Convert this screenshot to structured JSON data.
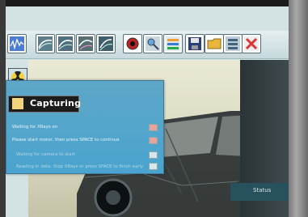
{
  "toolbar": {
    "buttons": [
      {
        "name": "waveform-icon",
        "color": "#4c7bd1"
      },
      {
        "name": "scan-1-icon"
      },
      {
        "name": "scan-2-icon"
      },
      {
        "name": "scan-3-icon"
      },
      {
        "name": "scan-4-icon"
      },
      {
        "name": "lens-icon"
      },
      {
        "name": "magnify-icon"
      },
      {
        "name": "filter-icon"
      },
      {
        "name": "save-icon"
      },
      {
        "name": "open-folder-icon"
      },
      {
        "name": "image-list-icon"
      },
      {
        "name": "delete-icon",
        "color": "#d33"
      }
    ]
  },
  "dialog": {
    "title": "Capturing",
    "steps": [
      {
        "text": "Waiting for XRays on",
        "state": "active"
      },
      {
        "text": "Please start motor, then press SPACE to continue",
        "state": "active"
      },
      {
        "text": "Waiting for camera to start",
        "state": "pending"
      },
      {
        "text": "Reading in data. Stop XRays or press SPACE to finish early",
        "state": "pending"
      }
    ]
  },
  "status": {
    "label": "Status"
  },
  "colors": {
    "dialog": "#4aa4cf",
    "toolbar": "#c7d9dc",
    "background": "#eae9d4"
  }
}
